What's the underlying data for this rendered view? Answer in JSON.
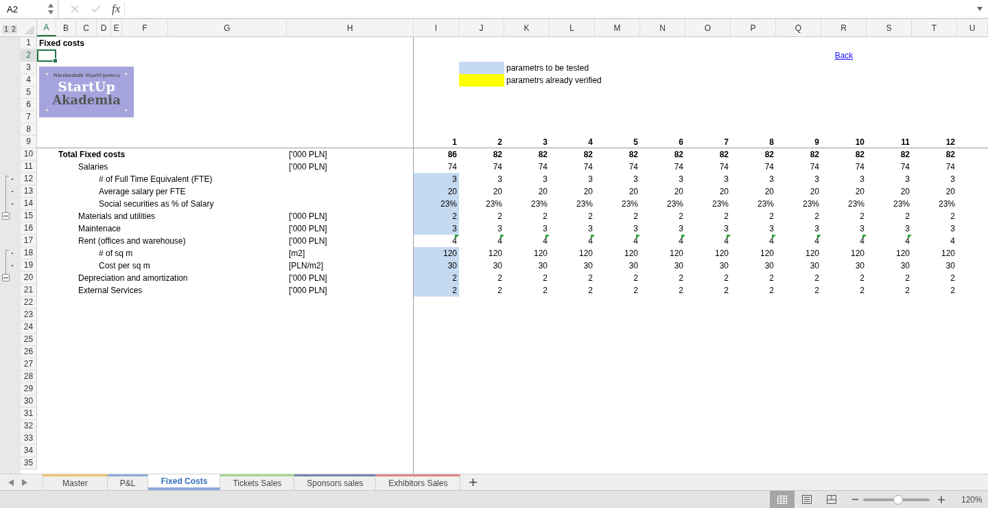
{
  "formula_bar": {
    "name_box": "A2",
    "function_label": "fx"
  },
  "outline_levels": [
    "1",
    "2"
  ],
  "columns": [
    {
      "label": "A",
      "selected": true
    },
    {
      "label": "B",
      "selected": false
    },
    {
      "label": "C",
      "selected": false
    },
    {
      "label": "D",
      "selected": false
    },
    {
      "label": "E",
      "selected": false
    },
    {
      "label": "F",
      "selected": false
    },
    {
      "label": "G",
      "selected": false
    },
    {
      "label": "H",
      "selected": false
    },
    {
      "label": "I",
      "selected": false
    },
    {
      "label": "J",
      "selected": false
    },
    {
      "label": "K",
      "selected": false
    },
    {
      "label": "L",
      "selected": false
    },
    {
      "label": "M",
      "selected": false
    },
    {
      "label": "N",
      "selected": false
    },
    {
      "label": "O",
      "selected": false
    },
    {
      "label": "P",
      "selected": false
    },
    {
      "label": "Q",
      "selected": false
    },
    {
      "label": "R",
      "selected": false
    },
    {
      "label": "S",
      "selected": false
    },
    {
      "label": "T",
      "selected": false
    },
    {
      "label": "U",
      "selected": false
    }
  ],
  "rows": [
    {
      "number": "1",
      "kind": "plain",
      "selected": false
    },
    {
      "number": "2",
      "kind": "plain",
      "selected": true
    },
    {
      "number": "3",
      "kind": "plain",
      "selected": false
    },
    {
      "number": "4",
      "kind": "plain",
      "selected": false
    },
    {
      "number": "5",
      "kind": "plain",
      "selected": false
    },
    {
      "number": "6",
      "kind": "plain",
      "selected": false
    },
    {
      "number": "7",
      "kind": "plain",
      "selected": false
    },
    {
      "number": "8",
      "kind": "plain",
      "selected": false
    },
    {
      "number": "9",
      "kind": "plain",
      "selected": false
    },
    {
      "number": "10",
      "kind": "plain",
      "selected": false
    },
    {
      "number": "11",
      "kind": "plain",
      "selected": false
    },
    {
      "number": "12",
      "kind": "grouped",
      "selected": false
    },
    {
      "number": "13",
      "kind": "grouped",
      "selected": false
    },
    {
      "number": "14",
      "kind": "grouped",
      "selected": false
    },
    {
      "number": "15",
      "kind": "group_summary",
      "selected": false
    },
    {
      "number": "16",
      "kind": "plain",
      "selected": false
    },
    {
      "number": "17",
      "kind": "plain",
      "selected": false
    },
    {
      "number": "18",
      "kind": "grouped",
      "selected": false
    },
    {
      "number": "19",
      "kind": "grouped",
      "selected": false
    },
    {
      "number": "20",
      "kind": "group_summary",
      "selected": false
    },
    {
      "number": "21",
      "kind": "plain",
      "selected": false
    },
    {
      "number": "22",
      "kind": "plain",
      "selected": false
    },
    {
      "number": "23",
      "kind": "plain",
      "selected": false
    },
    {
      "number": "24",
      "kind": "plain",
      "selected": false
    },
    {
      "number": "25",
      "kind": "plain",
      "selected": false
    },
    {
      "number": "26",
      "kind": "plain",
      "selected": false
    },
    {
      "number": "27",
      "kind": "plain",
      "selected": false
    },
    {
      "number": "28",
      "kind": "plain",
      "selected": false
    },
    {
      "number": "29",
      "kind": "plain",
      "selected": false
    },
    {
      "number": "30",
      "kind": "plain",
      "selected": false
    },
    {
      "number": "31",
      "kind": "plain",
      "selected": false
    },
    {
      "number": "32",
      "kind": "plain",
      "selected": false
    },
    {
      "number": "33",
      "kind": "plain",
      "selected": false
    },
    {
      "number": "34",
      "kind": "plain",
      "selected": false
    },
    {
      "number": "35",
      "kind": "plain",
      "selected": false
    }
  ],
  "title": "Fixed costs",
  "logo": {
    "tagline": "Niezbednik StartUpowca",
    "line_1": "StartUp",
    "line_2": "Akademia"
  },
  "back_link": "Back",
  "legend": [
    {
      "color": "#c5d9f1",
      "label": "parametrs to be tested"
    },
    {
      "color": "#ffff00",
      "label": "parametrs already verified"
    }
  ],
  "periods": [
    "1",
    "2",
    "3",
    "4",
    "5",
    "6",
    "7",
    "8",
    "9",
    "10",
    "11",
    "12"
  ],
  "line_items": [
    {
      "label": "Total Fixed costs",
      "unit": "['000 PLN]",
      "highlighted": false,
      "values": [
        "86",
        "82",
        "82",
        "82",
        "82",
        "82",
        "82",
        "82",
        "82",
        "82",
        "82",
        "82"
      ],
      "children": [
        {
          "label": "Salaries",
          "unit": "['000 PLN]",
          "highlighted": false,
          "values": [
            "74",
            "74",
            "74",
            "74",
            "74",
            "74",
            "74",
            "74",
            "74",
            "74",
            "74",
            "74"
          ],
          "children": [
            {
              "label": "# of Full Time Equivalent (FTE)",
              "highlighted": true,
              "values": [
                "3",
                "3",
                "3",
                "3",
                "3",
                "3",
                "3",
                "3",
                "3",
                "3",
                "3",
                "3"
              ]
            },
            {
              "label": "Average salary per FTE",
              "highlighted": true,
              "values": [
                "20",
                "20",
                "20",
                "20",
                "20",
                "20",
                "20",
                "20",
                "20",
                "20",
                "20",
                "20"
              ]
            },
            {
              "label": "Social securities as % of Salary",
              "highlighted": true,
              "values": [
                "23%",
                "23%",
                "23%",
                "23%",
                "23%",
                "23%",
                "23%",
                "23%",
                "23%",
                "23%",
                "23%",
                "23%"
              ]
            }
          ]
        },
        {
          "label": "Materials and utilities",
          "unit": "['000 PLN]",
          "highlighted": true,
          "values": [
            "2",
            "2",
            "2",
            "2",
            "2",
            "2",
            "2",
            "2",
            "2",
            "2",
            "2",
            "2"
          ]
        },
        {
          "label": "Maintenace",
          "unit": "['000 PLN]",
          "highlighted": true,
          "values": [
            "3",
            "3",
            "3",
            "3",
            "3",
            "3",
            "3",
            "3",
            "3",
            "3",
            "3",
            "3"
          ]
        },
        {
          "label": "Rent (offices and warehouse)",
          "unit": "['000 PLN]",
          "highlighted": false,
          "values": [
            "4",
            "4",
            "4",
            "4",
            "4",
            "4",
            "4",
            "4",
            "4",
            "4",
            "4",
            "4"
          ],
          "error_marks": [
            true,
            true,
            true,
            true,
            true,
            true,
            true,
            true,
            true,
            true,
            true,
            false
          ],
          "children": [
            {
              "label": "# of sq m",
              "unit": "[m2]",
              "highlighted": true,
              "values": [
                "120",
                "120",
                "120",
                "120",
                "120",
                "120",
                "120",
                "120",
                "120",
                "120",
                "120",
                "120"
              ]
            },
            {
              "label": "Cost per sq m",
              "unit": "[PLN/m2]",
              "highlighted": true,
              "values": [
                "30",
                "30",
                "30",
                "30",
                "30",
                "30",
                "30",
                "30",
                "30",
                "30",
                "30",
                "30"
              ]
            }
          ]
        },
        {
          "label": "Depreciation and amortization",
          "unit": "['000 PLN]",
          "highlighted": true,
          "values": [
            "2",
            "2",
            "2",
            "2",
            "2",
            "2",
            "2",
            "2",
            "2",
            "2",
            "2",
            "2"
          ]
        },
        {
          "label": "External Services",
          "unit": "['000 PLN]",
          "highlighted": true,
          "values": [
            "2",
            "2",
            "2",
            "2",
            "2",
            "2",
            "2",
            "2",
            "2",
            "2",
            "2",
            "2"
          ]
        }
      ]
    }
  ],
  "sheet_tabs": [
    {
      "label": "Master",
      "color": "#f2c46d",
      "selected": false
    },
    {
      "label": "P&L",
      "color": "#8faadc",
      "selected": false
    },
    {
      "label": "Fixed Costs",
      "color": "#8faadc",
      "selected": true
    },
    {
      "label": "Tickets Sales",
      "color": "#a9d98e",
      "selected": false
    },
    {
      "label": "Sponsors sales",
      "color": "#6f86ad",
      "selected": false
    },
    {
      "label": "Exhibitors Sales",
      "color": "#e08585",
      "selected": false
    }
  ],
  "status_bar": {
    "views": [
      {
        "kind": "normal",
        "selected": true
      },
      {
        "kind": "page_layout",
        "selected": false
      },
      {
        "kind": "page_break",
        "selected": false
      }
    ],
    "zoom": {
      "level": 0.53,
      "label": "120%"
    }
  }
}
